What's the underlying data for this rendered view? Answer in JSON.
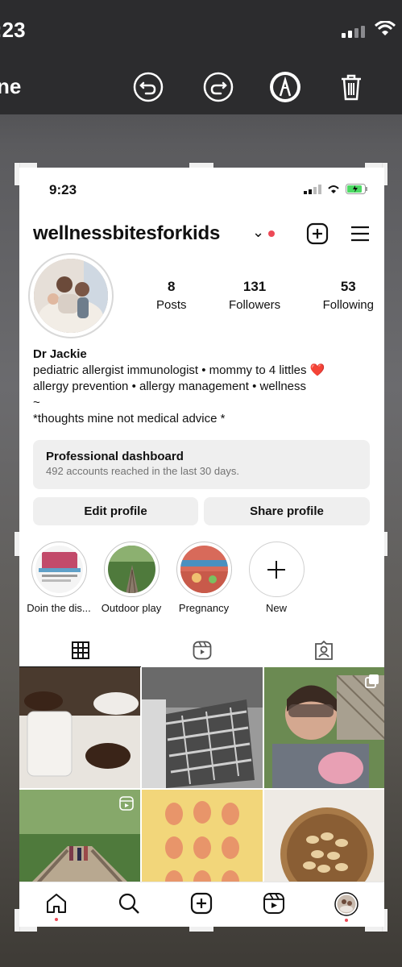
{
  "os": {
    "time": ":23",
    "editor_title": "ne"
  },
  "profile": {
    "status_time": "9:23",
    "username": "wellnessbitesforkids",
    "stats": [
      {
        "num": "8",
        "label": "Posts"
      },
      {
        "num": "131",
        "label": "Followers"
      },
      {
        "num": "53",
        "label": "Following"
      }
    ],
    "bio_name": "Dr Jackie",
    "bio_lines": [
      "pediatric allergist immunologist • mommy to 4 littles ❤️",
      "allergy prevention • allergy management • wellness",
      "~",
      "*thoughts mine not medical advice *"
    ],
    "dashboard": {
      "title": "Professional dashboard",
      "subtitle": "492 accounts reached in the last 30 days."
    },
    "buttons": {
      "edit": "Edit profile",
      "share": "Share profile"
    },
    "highlights": [
      {
        "label": "Doin the dis..."
      },
      {
        "label": "Outdoor play"
      },
      {
        "label": "Pregnancy"
      },
      {
        "label": "New"
      }
    ]
  },
  "colors": {
    "accent_red": "#ed4956",
    "button_bg": "#efefef"
  }
}
